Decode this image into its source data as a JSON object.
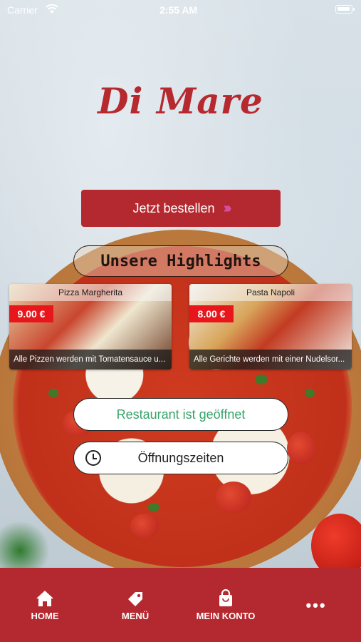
{
  "status_bar": {
    "carrier": "Carrier",
    "time": "2:55 AM",
    "wifi_icon": "wifi-icon",
    "battery_icon": "battery-icon"
  },
  "brand": {
    "logo_text": "Di Mare",
    "primary_color": "#b4292f"
  },
  "actions": {
    "order_label": "Jetzt bestellen",
    "order_icon": "double-chevron-right-icon"
  },
  "highlights": {
    "title": "Unsere Highlights",
    "items": [
      {
        "name": "Pizza Margherita",
        "price": "9.00 €",
        "description": "Alle Pizzen werden mit Tomatensauce u..."
      },
      {
        "name": "Pasta Napoli",
        "price": "8.00 €",
        "description": "Alle Gerichte werden mit einer Nudelsor..."
      }
    ]
  },
  "status": {
    "open_label": "Restaurant ist geöffnet",
    "open_color": "#36a36a",
    "hours_label": "Öffnungszeiten",
    "hours_icon": "clock-icon"
  },
  "tabbar": {
    "items": [
      {
        "label": "HOME",
        "icon": "home-icon"
      },
      {
        "label": "MENÜ",
        "icon": "tag-icon"
      },
      {
        "label": "MEIN KONTO",
        "icon": "shopping-bag-icon"
      },
      {
        "label": "•••",
        "icon": "more-icon"
      }
    ]
  }
}
